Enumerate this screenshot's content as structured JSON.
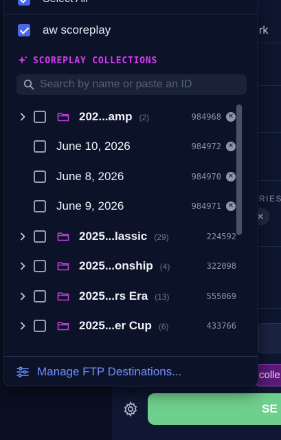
{
  "panel": {
    "select_all_label": "Select All",
    "account": {
      "label": "aw scoreplay",
      "checked": true
    },
    "section_title": "SCOREPLAY COLLECTIONS",
    "search": {
      "placeholder": "Search by name or paste an ID",
      "value": ""
    },
    "collections": [
      {
        "type": "folder",
        "name": "202...amp",
        "count": "(2)",
        "id": "984968",
        "expandable": true,
        "removable": true,
        "checked": false
      },
      {
        "type": "item",
        "name": "June 10, 2026",
        "id": "984972",
        "expandable": false,
        "removable": true,
        "checked": false
      },
      {
        "type": "item",
        "name": "June 8, 2026",
        "id": "984970",
        "expandable": false,
        "removable": true,
        "checked": false
      },
      {
        "type": "item",
        "name": "June 9, 2026",
        "id": "984971",
        "expandable": false,
        "removable": true,
        "checked": false
      },
      {
        "type": "folder",
        "name": "2025...lassic",
        "count": "(29)",
        "id": "224592",
        "expandable": true,
        "removable": false,
        "checked": false
      },
      {
        "type": "folder",
        "name": "2025...onship",
        "count": "(4)",
        "id": "322098",
        "expandable": true,
        "removable": false,
        "checked": false
      },
      {
        "type": "folder",
        "name": "2025...rs Era",
        "count": "(13)",
        "id": "555069",
        "expandable": true,
        "removable": false,
        "checked": false
      },
      {
        "type": "folder",
        "name": "2025...er Cup",
        "count": "(6)",
        "id": "433766",
        "expandable": true,
        "removable": false,
        "checked": false
      }
    ],
    "manage_link": "Manage FTP Destinations..."
  },
  "background": {
    "peek_text": "rk",
    "peek_label": "RIES",
    "peek_button": "colle",
    "send_label": "SE"
  },
  "colors": {
    "accent_magenta": "#d93cf5",
    "accent_blue": "#7190ff",
    "checkbox_checked": "#4a67e8",
    "send_green": "#6fcf8c",
    "folder_icon": "#c13ee0"
  },
  "icons": {
    "sparkle": "sparkle-icon",
    "search": "search-icon",
    "chevron": "chevron-right-icon",
    "folder": "folder-icon",
    "remove": "close-circle-icon",
    "manage": "sliders-icon",
    "settings": "gear-icon"
  }
}
